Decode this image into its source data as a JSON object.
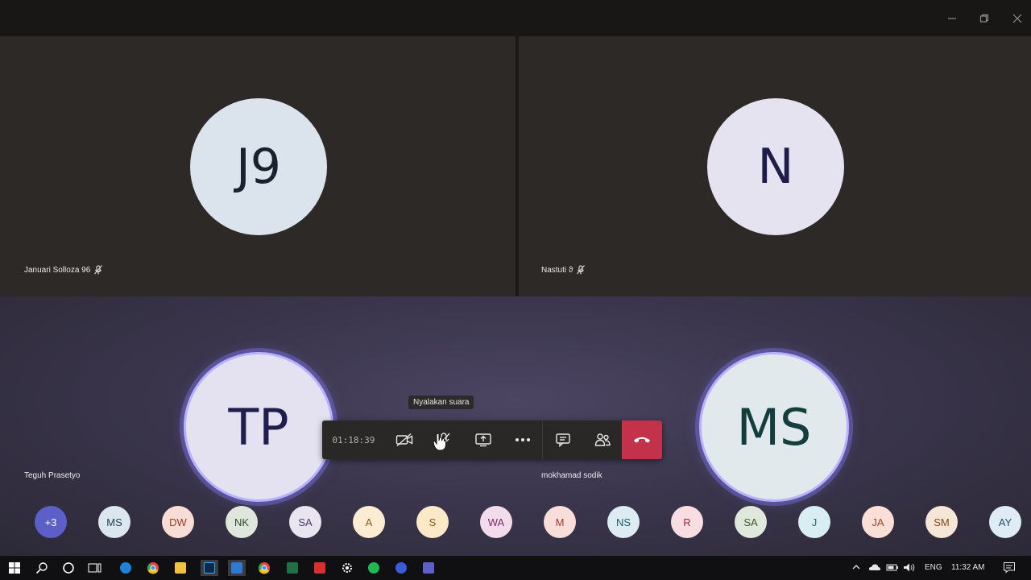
{
  "window": {
    "controls": [
      "minimize-icon",
      "restore-icon",
      "close-icon"
    ]
  },
  "tiles": [
    {
      "initials": "J9",
      "name": "Januari Solloza 96",
      "muted": true
    },
    {
      "initials": "N",
      "name": "Nastuti ϑ",
      "muted": true
    },
    {
      "initials": "TP",
      "name": "Teguh Prasetyo",
      "speaking": true
    },
    {
      "initials": "MS",
      "name": "mokhamad sodik",
      "speaking": true
    }
  ],
  "call_controls": {
    "timer": "01:18:39",
    "tooltip": "Nyalakan suara",
    "buttons": [
      "camera-off-icon",
      "mic-off-icon",
      "share-screen-icon",
      "more-icon",
      "chat-icon",
      "participants-icon",
      "hang-up-icon"
    ],
    "hangup_color": "#c4314b"
  },
  "roster": {
    "overflow": "+3",
    "participants": [
      {
        "initials": "MS",
        "bg": "#dbe6ee",
        "fg": "#1f3a55"
      },
      {
        "initials": "DW",
        "bg": "#f7ddd6",
        "fg": "#9c3b22"
      },
      {
        "initials": "NK",
        "bg": "#dfe6dc",
        "fg": "#2d4a2a"
      },
      {
        "initials": "SA",
        "bg": "#e8e4f0",
        "fg": "#4a3c6e"
      },
      {
        "initials": "A",
        "bg": "#fbecd2",
        "fg": "#8a5a12"
      },
      {
        "initials": "S",
        "bg": "#fbe9c8",
        "fg": "#8a5a12"
      },
      {
        "initials": "WA",
        "bg": "#f2dcec",
        "fg": "#7a2d66"
      },
      {
        "initials": "M",
        "bg": "#f8ddd8",
        "fg": "#a03a2a"
      },
      {
        "initials": "NS",
        "bg": "#dcecf2",
        "fg": "#1f5a6e"
      },
      {
        "initials": "R",
        "bg": "#f8dde3",
        "fg": "#9c2a44"
      },
      {
        "initials": "SA",
        "bg": "#e0e8dc",
        "fg": "#3a5a2a"
      },
      {
        "initials": "J",
        "bg": "#d9eef2",
        "fg": "#1f6a7a"
      },
      {
        "initials": "JA",
        "bg": "#fadfd6",
        "fg": "#a04428"
      },
      {
        "initials": "SM",
        "bg": "#f6e6d8",
        "fg": "#8a4a1a"
      },
      {
        "initials": "AY",
        "bg": "#dfecf6",
        "fg": "#1f4e76"
      }
    ],
    "overflow_bg": "#5b5fc7"
  },
  "taskbar": {
    "icons": [
      "windows-start-icon",
      "search-icon",
      "cortana-icon",
      "task-view-icon",
      "edge-icon",
      "chrome-icon",
      "file-explorer-icon",
      "photoshop-icon",
      "app-icon",
      "chrome-icon",
      "excel-icon",
      "acrobat-icon",
      "settings-icon",
      "spotify-icon",
      "vpn-icon",
      "teams-icon"
    ],
    "language": "ENG",
    "time": "11:32 AM"
  }
}
